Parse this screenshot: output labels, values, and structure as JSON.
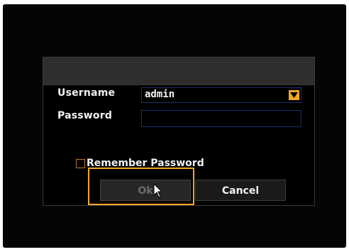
{
  "login": {
    "username_label": "Username",
    "username_value": "admin",
    "password_label": "Password",
    "password_value": "",
    "remember_label": "Remember Password",
    "remember_checked": false,
    "ok_label": "Ok",
    "cancel_label": "Cancel"
  },
  "icons": {
    "dropdown": "chevron-down-icon",
    "cursor": "mouse-cursor-icon"
  },
  "colors": {
    "accent": "#f1a826",
    "field_border": "#1c2c6c",
    "background": "#000000"
  }
}
